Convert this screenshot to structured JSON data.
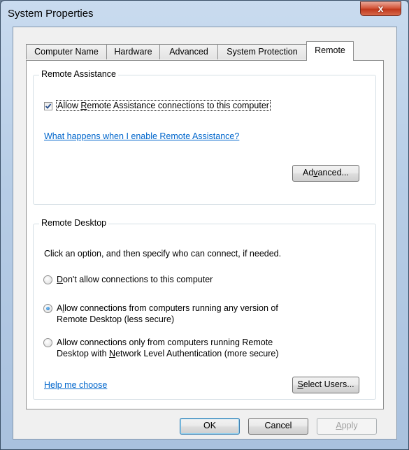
{
  "window": {
    "title": "System Properties",
    "close_glyph": "x"
  },
  "tabs": [
    {
      "label": "Computer Name"
    },
    {
      "label": "Hardware"
    },
    {
      "label": "Advanced"
    },
    {
      "label": "System Protection"
    },
    {
      "label": "Remote",
      "active": true
    }
  ],
  "remote_assistance": {
    "group_title": "Remote Assistance",
    "checkbox": {
      "checked": true,
      "pre": "Allow ",
      "accel": "R",
      "post": "emote Assistance connections to this computer"
    },
    "help_link": "What happens when I enable Remote Assistance?",
    "advanced_button": {
      "pre": "Ad",
      "accel": "v",
      "post": "anced..."
    }
  },
  "remote_desktop": {
    "group_title": "Remote Desktop",
    "instructions": "Click an option, and then specify who can connect, if needed.",
    "options": [
      {
        "selected": false,
        "accel": "D",
        "line1": "on't allow connections to this computer"
      },
      {
        "selected": true,
        "pre": "A",
        "accel": "l",
        "line1": "low connections from computers running any version of",
        "line2": "Remote Desktop (less secure)"
      },
      {
        "selected": false,
        "line1": "Allow connections only from computers running Remote",
        "line2_pre": "Desktop with ",
        "accel": "N",
        "line2_post": "etwork Level Authentication (more secure)"
      }
    ],
    "help_link": "Help me choose",
    "select_users_button": {
      "accel": "S",
      "post": "elect Users..."
    }
  },
  "footer": {
    "ok": "OK",
    "cancel": "Cancel",
    "apply_accel": "A",
    "apply_post": "pply"
  },
  "colors": {
    "link": "#0066cc",
    "close_red": "#c0391d",
    "frame_blue": "#b7cde6"
  }
}
